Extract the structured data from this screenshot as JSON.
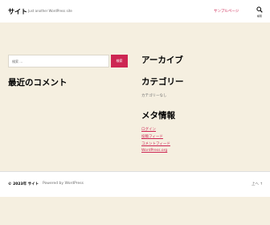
{
  "header": {
    "site_title": "サイト",
    "tagline": "Just another WordPress site",
    "nav_item": "サンプルページ",
    "search_label": "検索",
    "search_icon": "search-icon"
  },
  "search_widget": {
    "placeholder": "検索 …",
    "button_label": "検索"
  },
  "widgets": {
    "recent_comments_title": "最近のコメント",
    "archives_title": "アーカイブ",
    "categories_title": "カテゴリー",
    "categories_empty": "カテゴリーなし",
    "meta_title": "メタ情報",
    "meta_links": [
      "ログイン",
      "投稿フィード",
      "コメントフィード",
      "WordPress.org"
    ]
  },
  "footer": {
    "copyright": "© 2023年 サイト",
    "powered_by": "Powered by WordPress",
    "to_top": "上へ ↑"
  },
  "colors": {
    "accent": "#cd2653",
    "background": "#f5efe0",
    "header_bg": "#ffffff"
  }
}
